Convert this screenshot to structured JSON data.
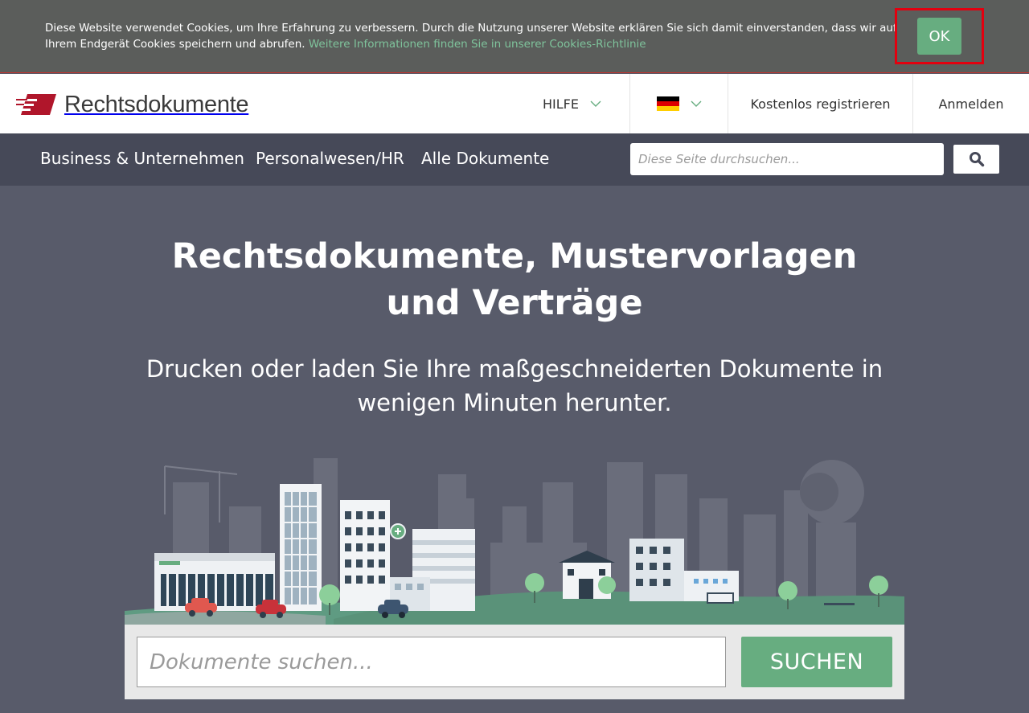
{
  "cookie_bar": {
    "text": "Diese Website verwendet Cookies, um Ihre Erfahrung zu verbessern. Durch die Nutzung unserer Website erklären Sie sich damit einverstanden, dass wir auf Ihrem Endgerät Cookies speichern und abrufen. ",
    "link_text": "Weitere Informationen finden Sie in unserer Cookies-Richtlinie",
    "ok_label": "OK"
  },
  "header": {
    "logo_text": "Rechtsdokumente",
    "help_label": "HILFE",
    "language_flag": "german-flag",
    "register_label": "Kostenlos registrieren",
    "login_label": "Anmelden"
  },
  "subnav": {
    "links": [
      "Business & Unternehmen",
      "Personalwesen/HR",
      "Alle Dokumente"
    ],
    "search_placeholder": "Diese Seite durchsuchen..."
  },
  "hero": {
    "title": "Rechtsdokumente, Mustervorlagen und Verträge",
    "subtitle": "Drucken oder laden Sie Ihre maßgeschneiderten Dokumente in wenigen Minuten herunter."
  },
  "doc_search": {
    "placeholder": "Dokumente suchen...",
    "button_label": "SUCHEN"
  },
  "colors": {
    "accent_green": "#67ad80",
    "nav_dark": "#464958",
    "hero_bg": "#585b6a",
    "brand_red": "#b0162b"
  }
}
